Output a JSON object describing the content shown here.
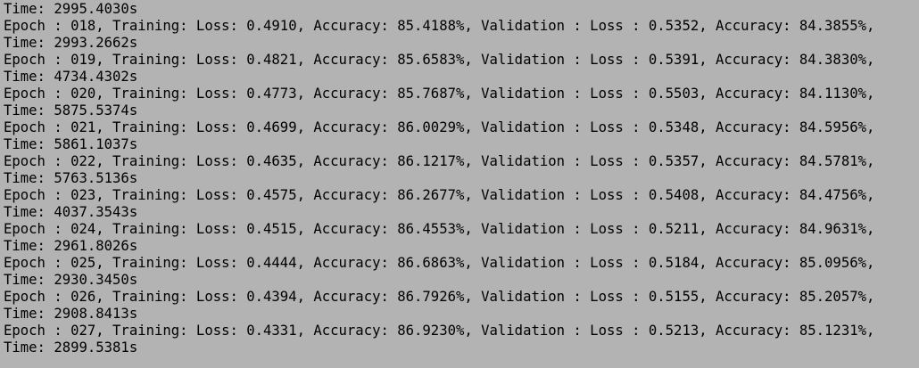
{
  "terminal": {
    "lines": [
      "Time: 2995.4030s",
      "Epoch : 018, Training: Loss: 0.4910, Accuracy: 85.4188%, Validation : Loss : 0.5352, Accuracy: 84.3855%,",
      "Time: 2993.2662s",
      "Epoch : 019, Training: Loss: 0.4821, Accuracy: 85.6583%, Validation : Loss : 0.5391, Accuracy: 84.3830%,",
      "Time: 4734.4302s",
      "Epoch : 020, Training: Loss: 0.4773, Accuracy: 85.7687%, Validation : Loss : 0.5503, Accuracy: 84.1130%,",
      "Time: 5875.5374s",
      "Epoch : 021, Training: Loss: 0.4699, Accuracy: 86.0029%, Validation : Loss : 0.5348, Accuracy: 84.5956%,",
      "Time: 5861.1037s",
      "Epoch : 022, Training: Loss: 0.4635, Accuracy: 86.1217%, Validation : Loss : 0.5357, Accuracy: 84.5781%,",
      "Time: 5763.5136s",
      "Epoch : 023, Training: Loss: 0.4575, Accuracy: 86.2677%, Validation : Loss : 0.5408, Accuracy: 84.4756%,",
      "Time: 4037.3543s",
      "Epoch : 024, Training: Loss: 0.4515, Accuracy: 86.4553%, Validation : Loss : 0.5211, Accuracy: 84.9631%,",
      "Time: 2961.8026s",
      "Epoch : 025, Training: Loss: 0.4444, Accuracy: 86.6863%, Validation : Loss : 0.5184, Accuracy: 85.0956%,",
      "Time: 2930.3450s",
      "Epoch : 026, Training: Loss: 0.4394, Accuracy: 86.7926%, Validation : Loss : 0.5155, Accuracy: 85.2057%,",
      "Time: 2908.8413s",
      "Epoch : 027, Training: Loss: 0.4331, Accuracy: 86.9230%, Validation : Loss : 0.5213, Accuracy: 85.1231%,",
      "Time: 2899.5381s"
    ]
  }
}
